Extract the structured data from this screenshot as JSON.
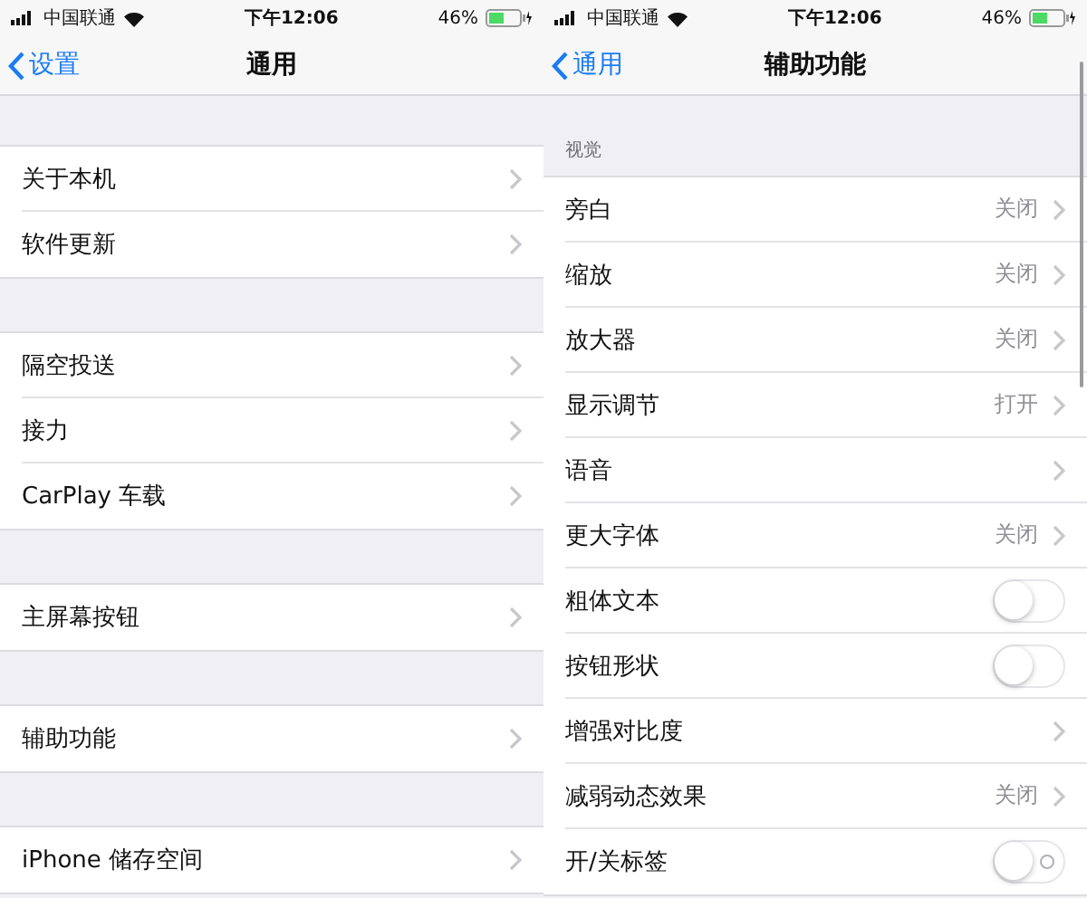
{
  "screens": [
    {
      "status_bar": {
        "carrier": "中国联通",
        "time": "下午12:06",
        "battery": "46%"
      },
      "nav": {
        "back": "设置",
        "title": "通用"
      },
      "groups": [
        {
          "rows": [
            {
              "label": "关于本机",
              "kind": "link"
            },
            {
              "label": "软件更新",
              "kind": "link"
            }
          ]
        },
        {
          "rows": [
            {
              "label": "隔空投送",
              "kind": "link"
            },
            {
              "label": "接力",
              "kind": "link"
            },
            {
              "label": "CarPlay 车载",
              "kind": "link"
            }
          ]
        },
        {
          "rows": [
            {
              "label": "主屏幕按钮",
              "kind": "link"
            }
          ]
        },
        {
          "rows": [
            {
              "label": "辅助功能",
              "kind": "link"
            }
          ]
        },
        {
          "rows": [
            {
              "label": "iPhone 储存空间",
              "kind": "link"
            }
          ]
        }
      ]
    },
    {
      "status_bar": {
        "carrier": "中国联通",
        "time": "下午12:06",
        "battery": "46%"
      },
      "nav": {
        "back": "通用",
        "title": "辅助功能"
      },
      "groups": [
        {
          "header": "视觉",
          "rows": [
            {
              "label": "旁白",
              "kind": "value",
              "value": "关闭"
            },
            {
              "label": "缩放",
              "kind": "value",
              "value": "关闭"
            },
            {
              "label": "放大器",
              "kind": "value",
              "value": "关闭"
            },
            {
              "label": "显示调节",
              "kind": "value",
              "value": "打开"
            },
            {
              "label": "语音",
              "kind": "link"
            },
            {
              "label": "更大字体",
              "kind": "value",
              "value": "关闭"
            },
            {
              "label": "粗体文本",
              "kind": "toggle",
              "on": false
            },
            {
              "label": "按钮形状",
              "kind": "toggle",
              "on": false
            },
            {
              "label": "增强对比度",
              "kind": "link"
            },
            {
              "label": "减弱动态效果",
              "kind": "value",
              "value": "关闭"
            },
            {
              "label": "开/关标签",
              "kind": "toggle",
              "on": false,
              "label_marks": true
            }
          ]
        }
      ]
    }
  ]
}
